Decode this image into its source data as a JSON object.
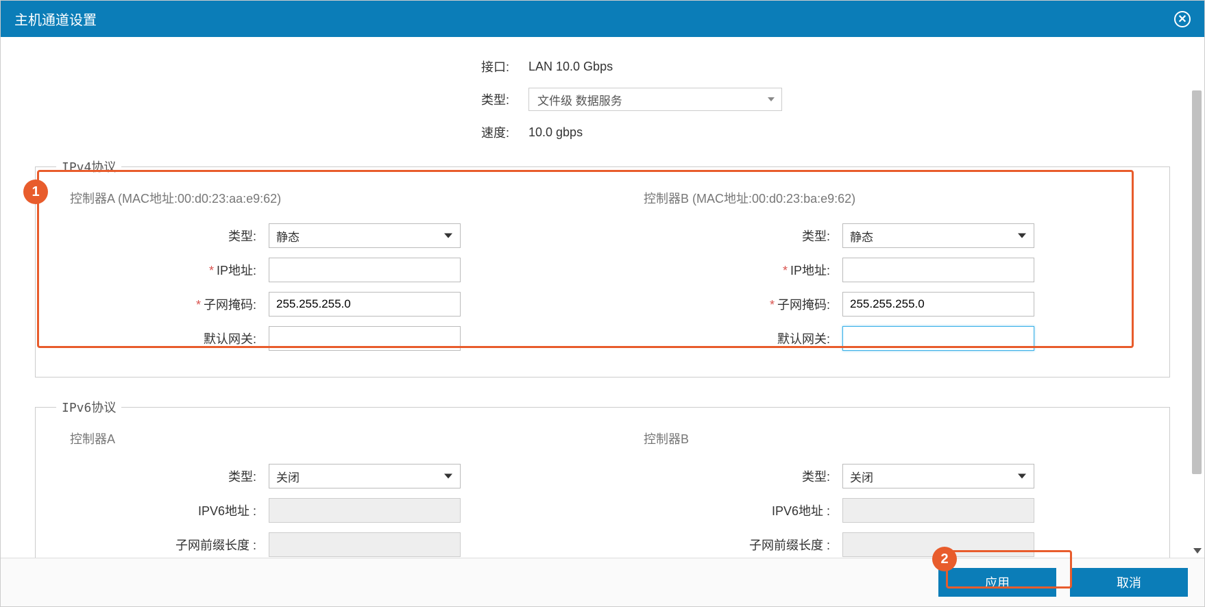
{
  "header": {
    "title": "主机通道设置"
  },
  "topInfo": {
    "interfaceLabel": "接口:",
    "interfaceValue": "LAN 10.0 Gbps",
    "typeLabel": "类型:",
    "typeValue": "文件级 数据服务",
    "speedLabel": "速度:",
    "speedValue": "10.0 gbps"
  },
  "ipv4": {
    "legend": "IPv4协议",
    "controllerA": {
      "title": "控制器A (MAC地址:00:d0:23:aa:e9:62)",
      "typeLabel": "类型:",
      "typeValue": "静态",
      "ipLabel": "IP地址:",
      "ipValue": "",
      "maskLabel": "子网掩码:",
      "maskValue": "255.255.255.0",
      "gatewayLabel": "默认网关:",
      "gatewayValue": ""
    },
    "controllerB": {
      "title": "控制器B (MAC地址:00:d0:23:ba:e9:62)",
      "typeLabel": "类型:",
      "typeValue": "静态",
      "ipLabel": "IP地址:",
      "ipValue": "",
      "maskLabel": "子网掩码:",
      "maskValue": "255.255.255.0",
      "gatewayLabel": "默认网关:",
      "gatewayValue": ""
    }
  },
  "ipv6": {
    "legend": "IPv6协议",
    "controllerA": {
      "title": "控制器A",
      "typeLabel": "类型:",
      "typeValue": "关闭",
      "ipv6Label": "IPV6地址 :",
      "ipv6Value": "",
      "prefixLabel": "子网前缀长度 :",
      "prefixValue": ""
    },
    "controllerB": {
      "title": "控制器B",
      "typeLabel": "类型:",
      "typeValue": "关闭",
      "ipv6Label": "IPV6地址 :",
      "ipv6Value": "",
      "prefixLabel": "子网前缀长度 :",
      "prefixValue": ""
    }
  },
  "footer": {
    "applyLabel": "应用",
    "cancelLabel": "取消"
  },
  "callouts": {
    "one": "1",
    "two": "2"
  }
}
